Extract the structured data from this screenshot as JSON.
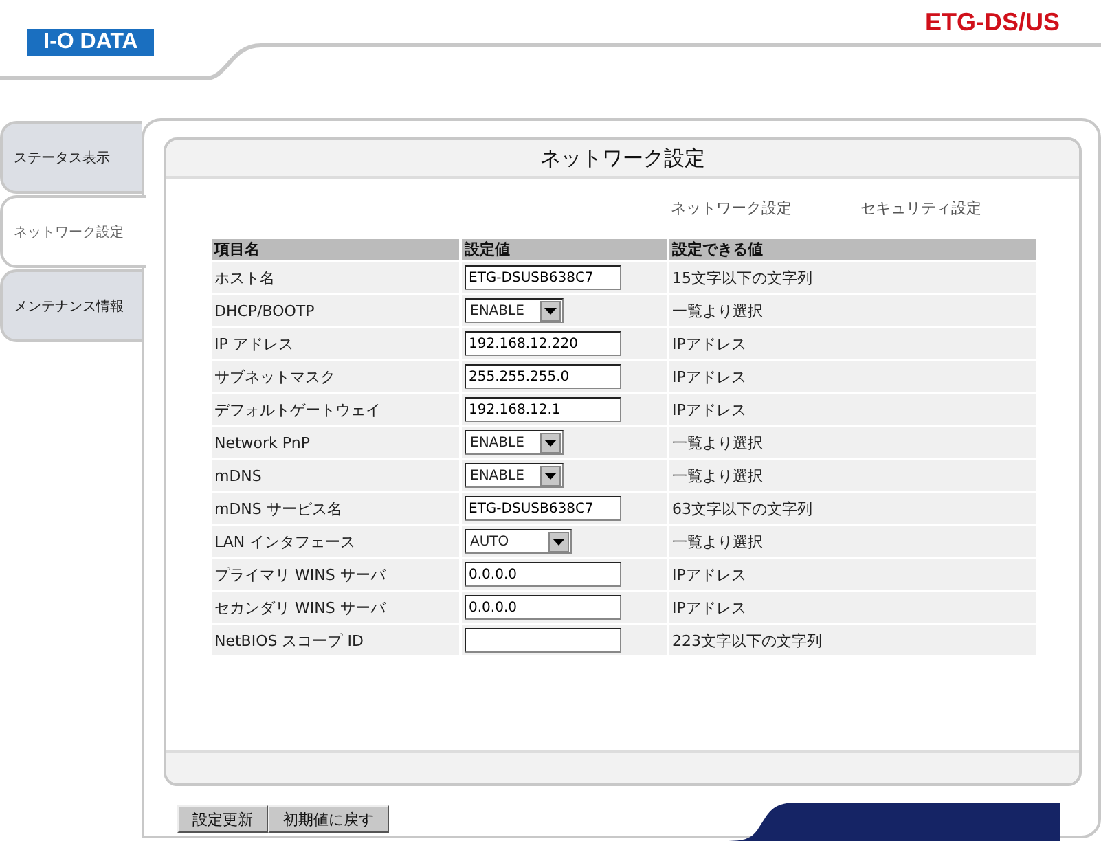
{
  "header": {
    "logo": "I-O DATA",
    "model": "ETG-DS/US"
  },
  "side_tabs": [
    {
      "label": "ステータス表示",
      "selected": false
    },
    {
      "label": "ネットワーク設定",
      "selected": true
    },
    {
      "label": "メンテナンス情報",
      "selected": false
    }
  ],
  "panel": {
    "title": "ネットワーク設定"
  },
  "sub_links": [
    "ネットワーク設定",
    "セキュリティ設定"
  ],
  "table": {
    "columns": [
      "項目名",
      "設定値",
      "設定できる値"
    ],
    "rows": [
      {
        "name": "ホスト名",
        "kind": "text",
        "value": "ETG-DSUSB638C7",
        "allowed": "15文字以下の文字列"
      },
      {
        "name": "DHCP/BOOTP",
        "kind": "select",
        "value": "ENABLE",
        "allowed": "一覧より選択"
      },
      {
        "name": "IP アドレス",
        "kind": "text",
        "value": "192.168.12.220",
        "allowed": "IPアドレス"
      },
      {
        "name": "サブネットマスク",
        "kind": "text",
        "value": "255.255.255.0",
        "allowed": "IPアドレス"
      },
      {
        "name": "デフォルトゲートウェイ",
        "kind": "text",
        "value": "192.168.12.1",
        "allowed": "IPアドレス"
      },
      {
        "name": "Network PnP",
        "kind": "select",
        "value": "ENABLE",
        "allowed": "一覧より選択"
      },
      {
        "name": "mDNS",
        "kind": "select",
        "value": "ENABLE",
        "allowed": "一覧より選択"
      },
      {
        "name": "mDNS サービス名",
        "kind": "text",
        "value": "ETG-DSUSB638C7",
        "allowed": "63文字以下の文字列"
      },
      {
        "name": "LAN インタフェース",
        "kind": "select",
        "value": "AUTO",
        "allowed": "一覧より選択"
      },
      {
        "name": "プライマリ WINS サーバ",
        "kind": "text",
        "value": "0.0.0.0",
        "allowed": "IPアドレス"
      },
      {
        "name": "セカンダリ WINS サーバ",
        "kind": "text",
        "value": "0.0.0.0",
        "allowed": "IPアドレス"
      },
      {
        "name": "NetBIOS スコープ ID",
        "kind": "text",
        "value": "",
        "allowed": "223文字以下の文字列"
      }
    ]
  },
  "buttons": [
    "設定更新",
    "初期値に戻す"
  ]
}
